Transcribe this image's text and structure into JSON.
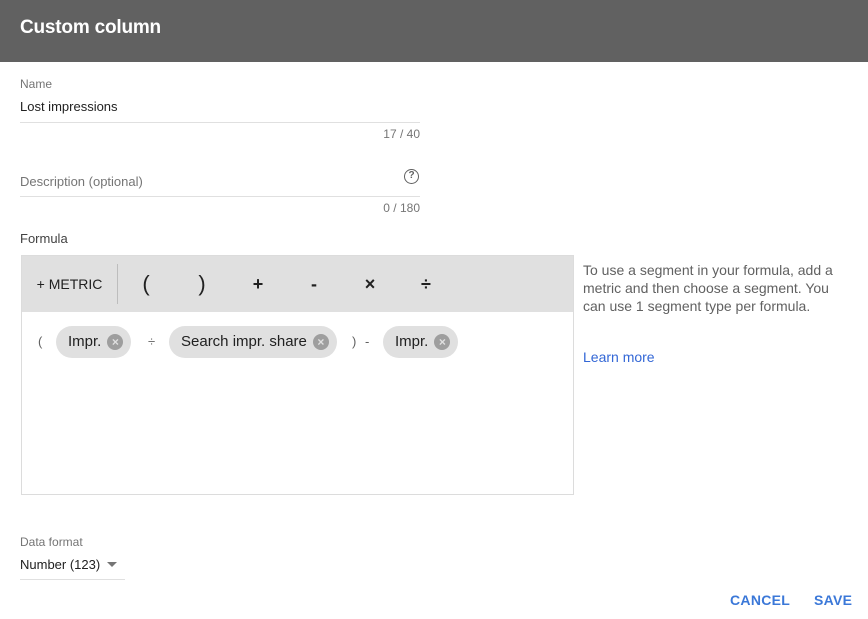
{
  "header": {
    "title": "Custom column"
  },
  "name_field": {
    "label": "Name",
    "value": "Lost impressions",
    "counter": "17 / 40"
  },
  "description_field": {
    "placeholder": "Description (optional)",
    "counter": "0 / 180",
    "help_icon": "help-circle-icon"
  },
  "formula": {
    "label": "Formula",
    "toolbar": {
      "metric_button": "+ METRIC",
      "operators": [
        "(",
        ")",
        "+",
        "-",
        "×",
        "÷"
      ]
    },
    "tokens": {
      "open_paren": "(",
      "chip1": "Impr.",
      "divide": "÷",
      "chip2": "Search impr. share",
      "close_paren": ")",
      "minus": "-",
      "chip3": "Impr."
    },
    "chip_close_glyph": "×"
  },
  "help": {
    "text": "To use a segment in your formula, add a metric and then choose a segment. You can use 1 segment type per formula.",
    "link": "Learn more"
  },
  "data_format": {
    "label": "Data format",
    "value": "Number (123)"
  },
  "actions": {
    "cancel": "CANCEL",
    "save": "SAVE"
  },
  "colors": {
    "header_bg": "#616161",
    "accent": "#3b78d8",
    "toolbar_bg": "#e0e0e0",
    "chip_bg": "#e0e0e0"
  }
}
